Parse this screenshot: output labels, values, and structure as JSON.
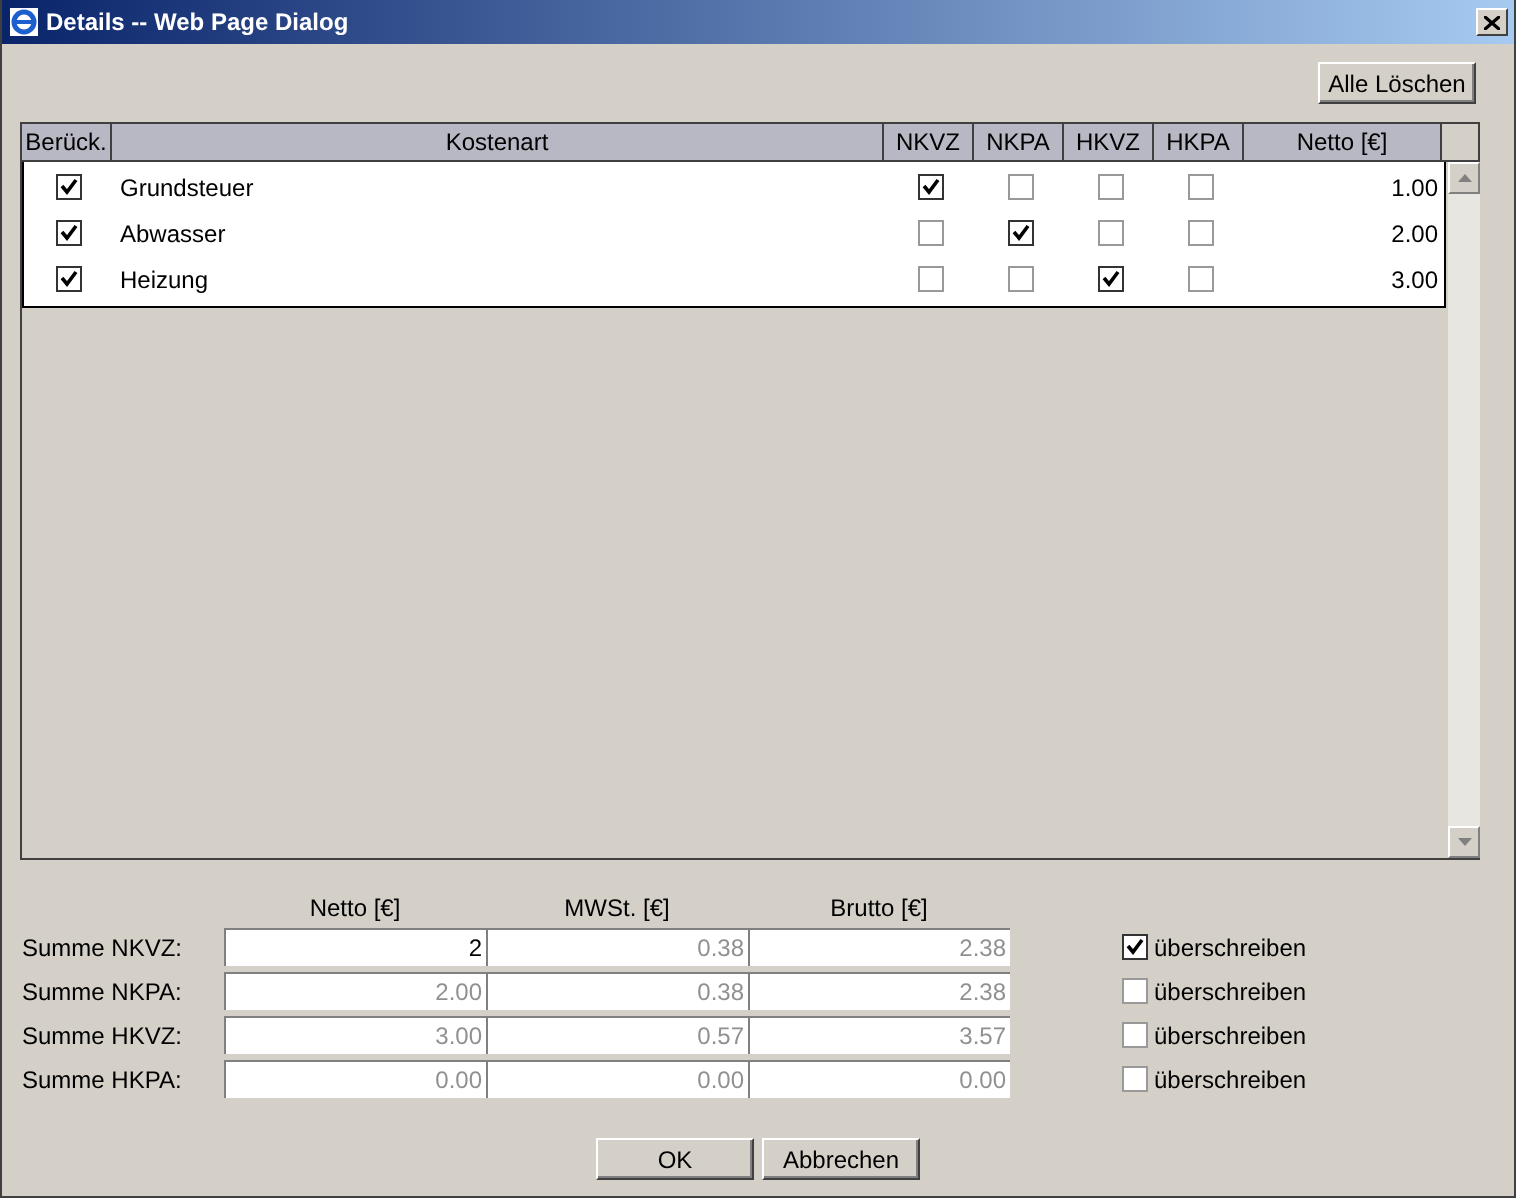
{
  "window": {
    "title": "Details -- Web Page Dialog"
  },
  "clear_button": "Alle Löschen",
  "table": {
    "columns": [
      "Berück.",
      "Kostenart",
      "NKVZ",
      "NKPA",
      "HKVZ",
      "HKPA",
      "Netto [€]"
    ],
    "rows": [
      {
        "included": true,
        "name": "Grundsteuer",
        "nkvz": true,
        "nkpa": false,
        "hkvz": false,
        "hkpa": false,
        "netto": "1.00"
      },
      {
        "included": true,
        "name": "Abwasser",
        "nkvz": false,
        "nkpa": true,
        "hkvz": false,
        "hkpa": false,
        "netto": "2.00"
      },
      {
        "included": true,
        "name": "Heizung",
        "nkvz": false,
        "nkpa": false,
        "hkvz": true,
        "hkpa": false,
        "netto": "3.00"
      }
    ]
  },
  "sums": {
    "columns": [
      "Netto [€]",
      "MWSt. [€]",
      "Brutto [€]"
    ],
    "rows": [
      {
        "label": "Summe NKVZ:",
        "netto": "2",
        "mwst": "0.38",
        "brutto": "2.38",
        "overwrite": true,
        "overwrite_label": "überschreiben"
      },
      {
        "label": "Summe NKPA:",
        "netto": "2.00",
        "mwst": "0.38",
        "brutto": "2.38",
        "overwrite": false,
        "overwrite_label": "überschreiben"
      },
      {
        "label": "Summe HKVZ:",
        "netto": "3.00",
        "mwst": "0.57",
        "brutto": "3.57",
        "overwrite": false,
        "overwrite_label": "überschreiben"
      },
      {
        "label": "Summe HKPA:",
        "netto": "0.00",
        "mwst": "0.00",
        "brutto": "0.00",
        "overwrite": false,
        "overwrite_label": "überschreiben"
      }
    ]
  },
  "buttons": [
    "OK",
    "Abbrechen"
  ]
}
